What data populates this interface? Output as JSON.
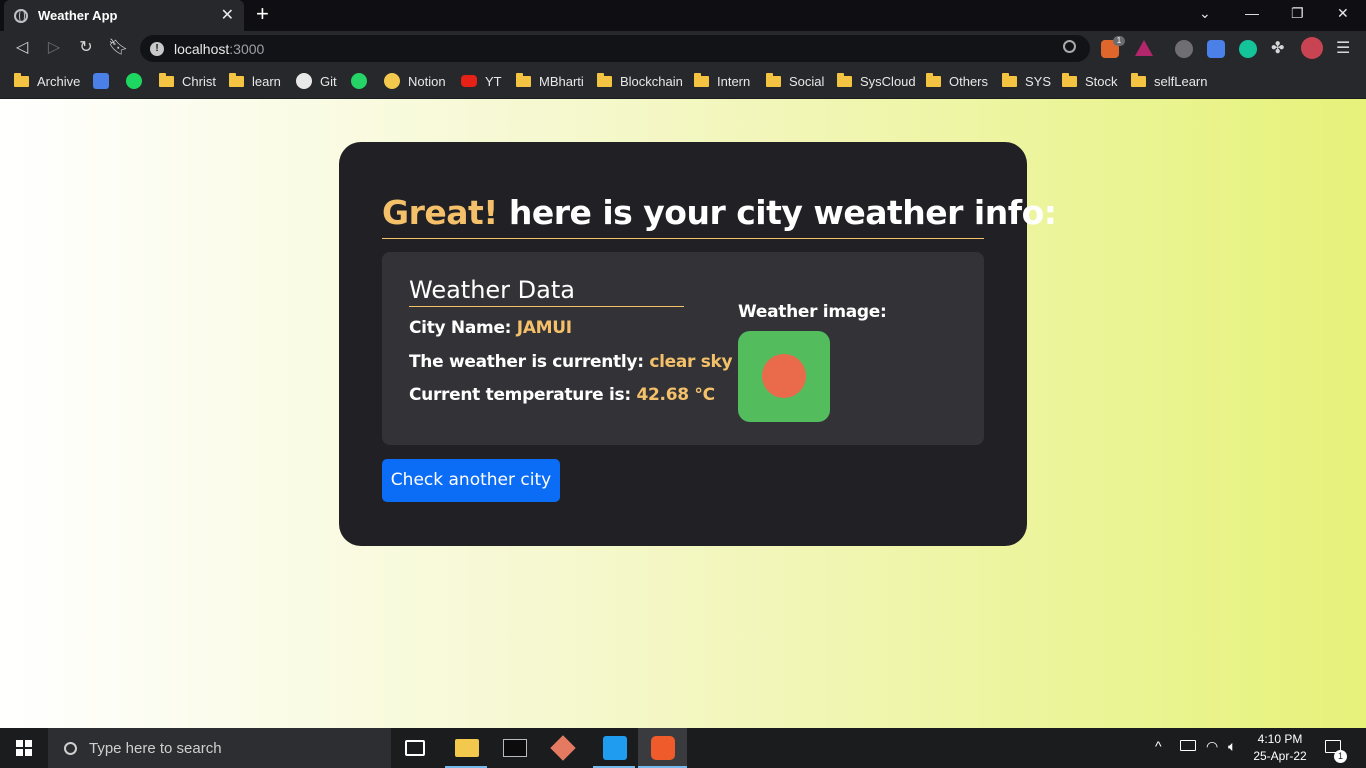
{
  "browser": {
    "tab_title": "Weather App",
    "tab_close": "✕",
    "new_tab": "+",
    "url_host": "localhost",
    "url_port": ":3000",
    "bookmarks": [
      "Archive",
      "Christ",
      "learn",
      "Git",
      "Notion",
      "YT",
      "MBharti",
      "Blockchain",
      "Intern",
      "Social",
      "SysCloud",
      "Others",
      "SYS",
      "Stock",
      "selfLearn"
    ],
    "brave_badge": "1"
  },
  "page": {
    "heading_highlight": "Great!",
    "heading_rest": " here is your city weather info:",
    "section_title": "Weather Data",
    "city_label": "City Name: ",
    "city_value": "JAMUI",
    "weather_label": "The weather is currently: ",
    "weather_value": "clear sky",
    "temp_label": "Current temperature is: ",
    "temp_value": "42.68 °C",
    "image_label": "Weather image:",
    "button_label": "Check another city",
    "colors": {
      "accent": "#f4c06a",
      "card": "#212125",
      "button": "#0b6cf5",
      "weather_image_bg": "#53bd5e",
      "sun": "#ea6a4c"
    }
  },
  "taskbar": {
    "search_placeholder": "Type here to search",
    "time": "4:10 PM",
    "date": "25-Apr-22",
    "notification_count": "1"
  }
}
